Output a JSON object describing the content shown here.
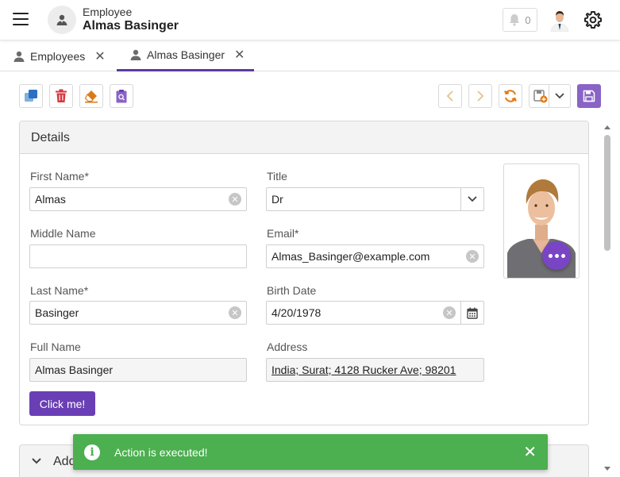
{
  "header": {
    "subtitle": "Employee",
    "title": "Almas Basinger",
    "notification_count": "0"
  },
  "tabs": [
    {
      "label": "Employees",
      "close": "✕"
    },
    {
      "label": "Almas Basinger",
      "close": "✕"
    }
  ],
  "details": {
    "title": "Details",
    "first_name": {
      "label": "First Name*",
      "value": "Almas"
    },
    "middle_name": {
      "label": "Middle Name",
      "value": ""
    },
    "last_name": {
      "label": "Last Name*",
      "value": "Basinger"
    },
    "full_name": {
      "label": "Full Name",
      "value": "Almas Basinger"
    },
    "title_field": {
      "label": "Title",
      "value": "Dr"
    },
    "email": {
      "label": "Email*",
      "value": "Almas_Basinger@example.com"
    },
    "birth_date": {
      "label": "Birth Date",
      "value": "4/20/1978"
    },
    "address": {
      "label": "Address",
      "value": "India; Surat; 4128 Rucker Ave; 98201"
    },
    "click_button": "Click me!"
  },
  "second_panel": {
    "title": "Add"
  },
  "toast": {
    "message": "Action is executed!",
    "close": "✕",
    "icon": "i"
  },
  "colors": {
    "accent": "#6a3fb5",
    "toast": "#4caf50",
    "save": "#8a63c7"
  }
}
